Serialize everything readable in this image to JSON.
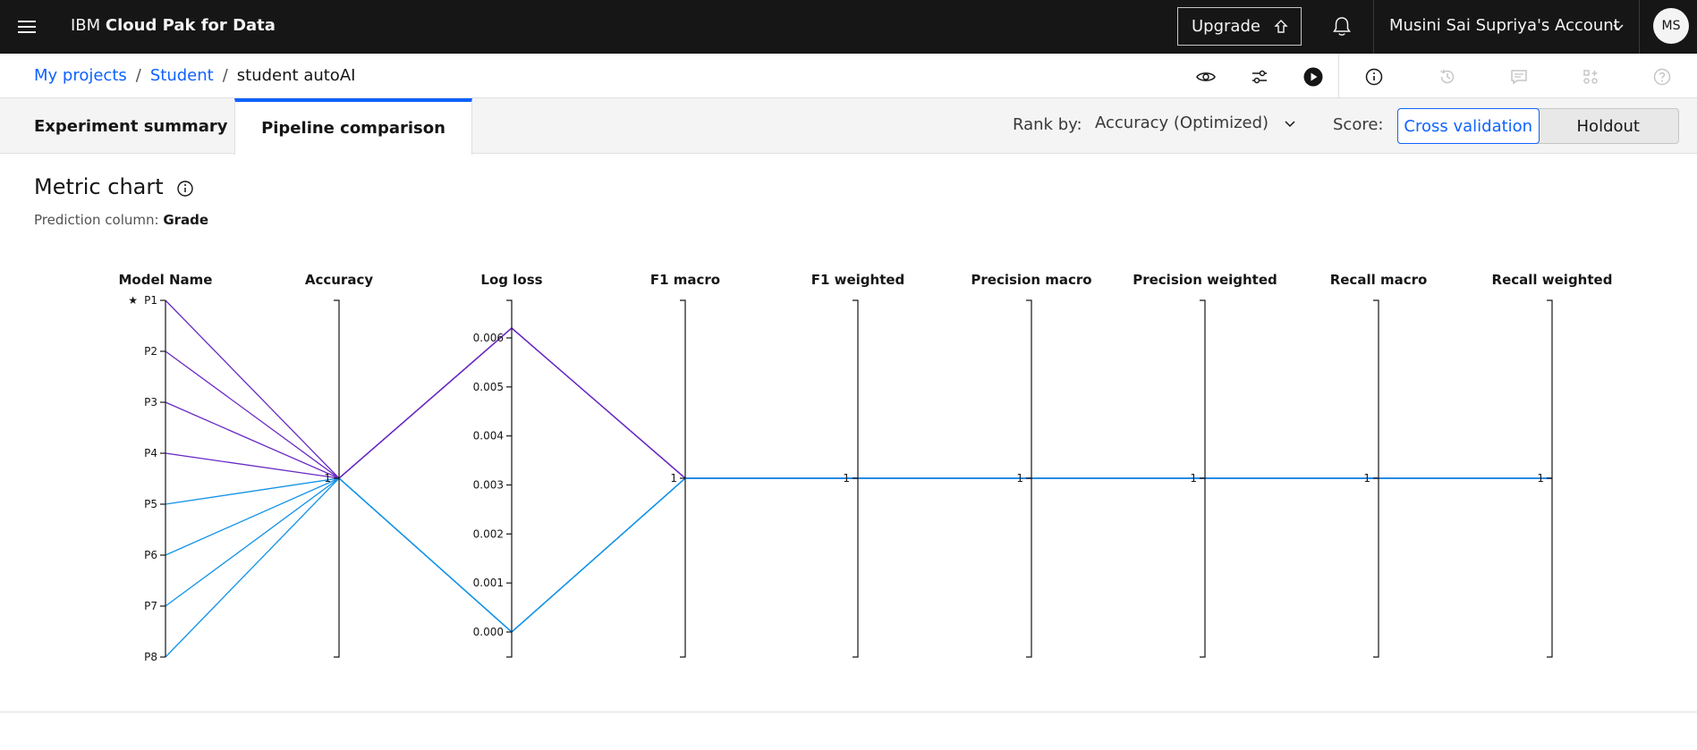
{
  "header": {
    "brand_ibm": "IBM ",
    "brand_product": "Cloud Pak for Data",
    "upgrade_label": "Upgrade",
    "account_label": "Musini Sai Supriya's Account",
    "avatar_initials": "MS"
  },
  "breadcrumb": {
    "items": [
      "My projects",
      "Student"
    ],
    "current": "student autoAI",
    "separator": "/"
  },
  "tabs": {
    "summary": "Experiment summary",
    "pipeline": "Pipeline comparison"
  },
  "controls": {
    "rank_label": "Rank by:",
    "rank_value": "Accuracy (Optimized)",
    "score_label": "Score:",
    "score_options": [
      "Cross validation",
      "Holdout"
    ],
    "score_selected": "Cross validation"
  },
  "chart_section": {
    "title": "Metric chart",
    "prediction_label": "Prediction column:",
    "prediction_value": "Grade"
  },
  "colors": {
    "accent": "#0f62fe",
    "purple_series": "#6929c4",
    "blue_series": "#1192e8"
  },
  "chart_data": {
    "type": "parallel-coordinates",
    "axes": [
      "Model Name",
      "Accuracy",
      "Log loss",
      "F1 macro",
      "F1 weighted",
      "Precision macro",
      "Precision weighted",
      "Recall macro",
      "Recall weighted"
    ],
    "model_ticks": [
      "P1",
      "P2",
      "P3",
      "P4",
      "P5",
      "P6",
      "P7",
      "P8"
    ],
    "starred": "P1",
    "logloss_ticks": [
      "0.000",
      "0.001",
      "0.002",
      "0.003",
      "0.004",
      "0.005",
      "0.006"
    ],
    "metric_tick_label": "1",
    "series": [
      {
        "values": {
          "Model Name": "P1",
          "Accuracy": 1,
          "Log loss": 0.0062,
          "F1 macro": 1,
          "F1 weighted": 1,
          "Precision macro": 1,
          "Precision weighted": 1,
          "Recall macro": 1,
          "Recall weighted": 1
        },
        "color": "#6929c4"
      },
      {
        "values": {
          "Model Name": "P2",
          "Accuracy": 1,
          "Log loss": 0.0062,
          "F1 macro": 1,
          "F1 weighted": 1,
          "Precision macro": 1,
          "Precision weighted": 1,
          "Recall macro": 1,
          "Recall weighted": 1
        },
        "color": "#6929c4"
      },
      {
        "values": {
          "Model Name": "P3",
          "Accuracy": 1,
          "Log loss": 0.0062,
          "F1 macro": 1,
          "F1 weighted": 1,
          "Precision macro": 1,
          "Precision weighted": 1,
          "Recall macro": 1,
          "Recall weighted": 1
        },
        "color": "#6929c4"
      },
      {
        "values": {
          "Model Name": "P4",
          "Accuracy": 1,
          "Log loss": 0.0062,
          "F1 macro": 1,
          "F1 weighted": 1,
          "Precision macro": 1,
          "Precision weighted": 1,
          "Recall macro": 1,
          "Recall weighted": 1
        },
        "color": "#6929c4"
      },
      {
        "values": {
          "Model Name": "P5",
          "Accuracy": 1,
          "Log loss": 0.0,
          "F1 macro": 1,
          "F1 weighted": 1,
          "Precision macro": 1,
          "Precision weighted": 1,
          "Recall macro": 1,
          "Recall weighted": 1
        },
        "color": "#1192e8"
      },
      {
        "values": {
          "Model Name": "P6",
          "Accuracy": 1,
          "Log loss": 0.0,
          "F1 macro": 1,
          "F1 weighted": 1,
          "Precision macro": 1,
          "Precision weighted": 1,
          "Recall macro": 1,
          "Recall weighted": 1
        },
        "color": "#1192e8"
      },
      {
        "values": {
          "Model Name": "P7",
          "Accuracy": 1,
          "Log loss": 0.0,
          "F1 macro": 1,
          "F1 weighted": 1,
          "Precision macro": 1,
          "Precision weighted": 1,
          "Recall macro": 1,
          "Recall weighted": 1
        },
        "color": "#1192e8"
      },
      {
        "values": {
          "Model Name": "P8",
          "Accuracy": 1,
          "Log loss": 0.0,
          "F1 macro": 1,
          "F1 weighted": 1,
          "Precision macro": 1,
          "Precision weighted": 1,
          "Recall macro": 1,
          "Recall weighted": 1
        },
        "color": "#1192e8"
      }
    ]
  }
}
